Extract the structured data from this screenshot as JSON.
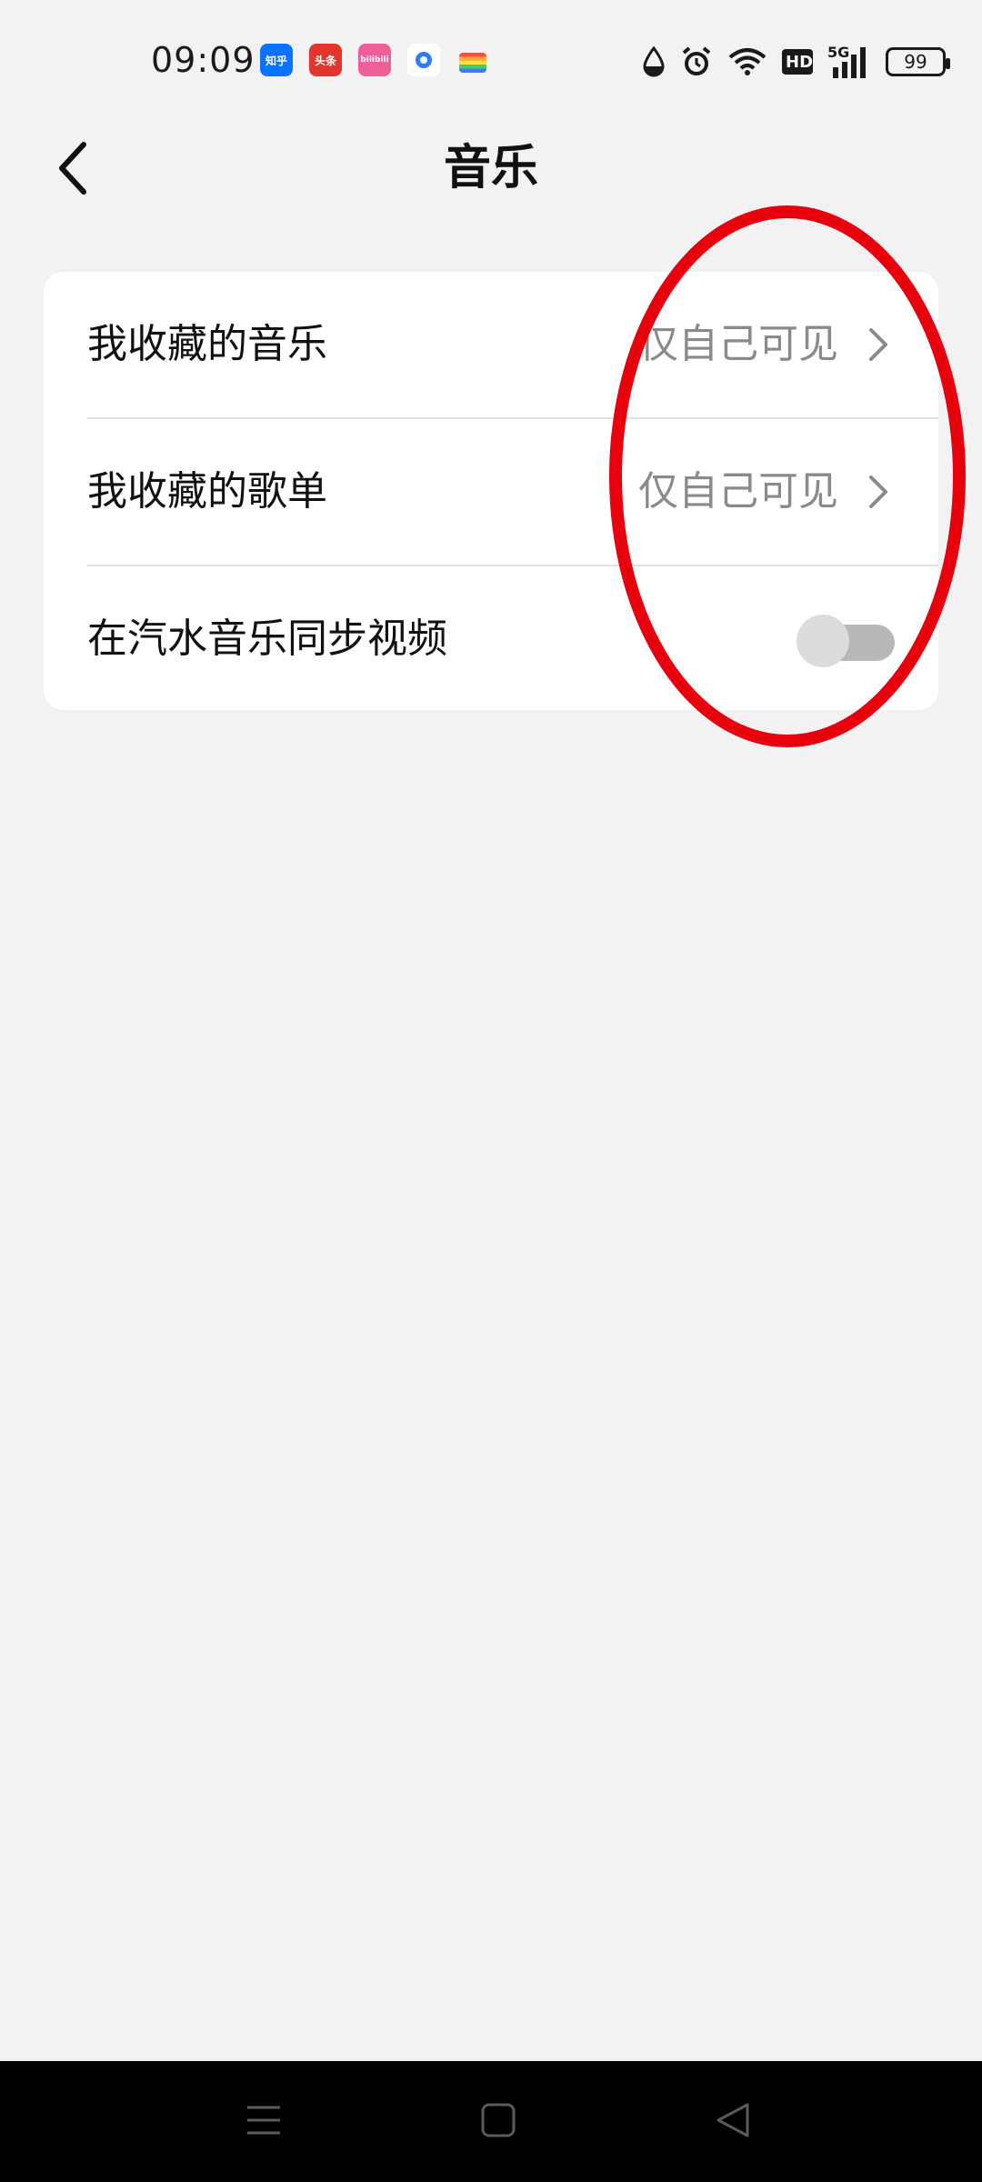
{
  "status_bar": {
    "time": "09:09",
    "apps": [
      {
        "label": "知乎",
        "icon": "zhihu-app-icon",
        "color": "#0a73ff"
      },
      {
        "label": "头条",
        "icon": "toutiao-app-icon",
        "color": "#e1352d"
      },
      {
        "label": "bilibili",
        "icon": "bilibili-app-icon",
        "color": "#ef5f98"
      }
    ],
    "hd_label": "HD",
    "network_label": "5G",
    "battery": "99"
  },
  "header": {
    "title": "音乐"
  },
  "settings": {
    "rows": [
      {
        "label": "我收藏的音乐",
        "value": "仅自己可见"
      },
      {
        "label": "我收藏的歌单",
        "value": "仅自己可见"
      },
      {
        "label": "在汽水音乐同步视频",
        "toggle_on": false
      }
    ]
  },
  "annotation": {
    "color": "#e8000d",
    "shape": "ellipse"
  },
  "nav_bar": {
    "icons": [
      "menu-icon",
      "home-icon",
      "back-triangle-icon"
    ]
  }
}
